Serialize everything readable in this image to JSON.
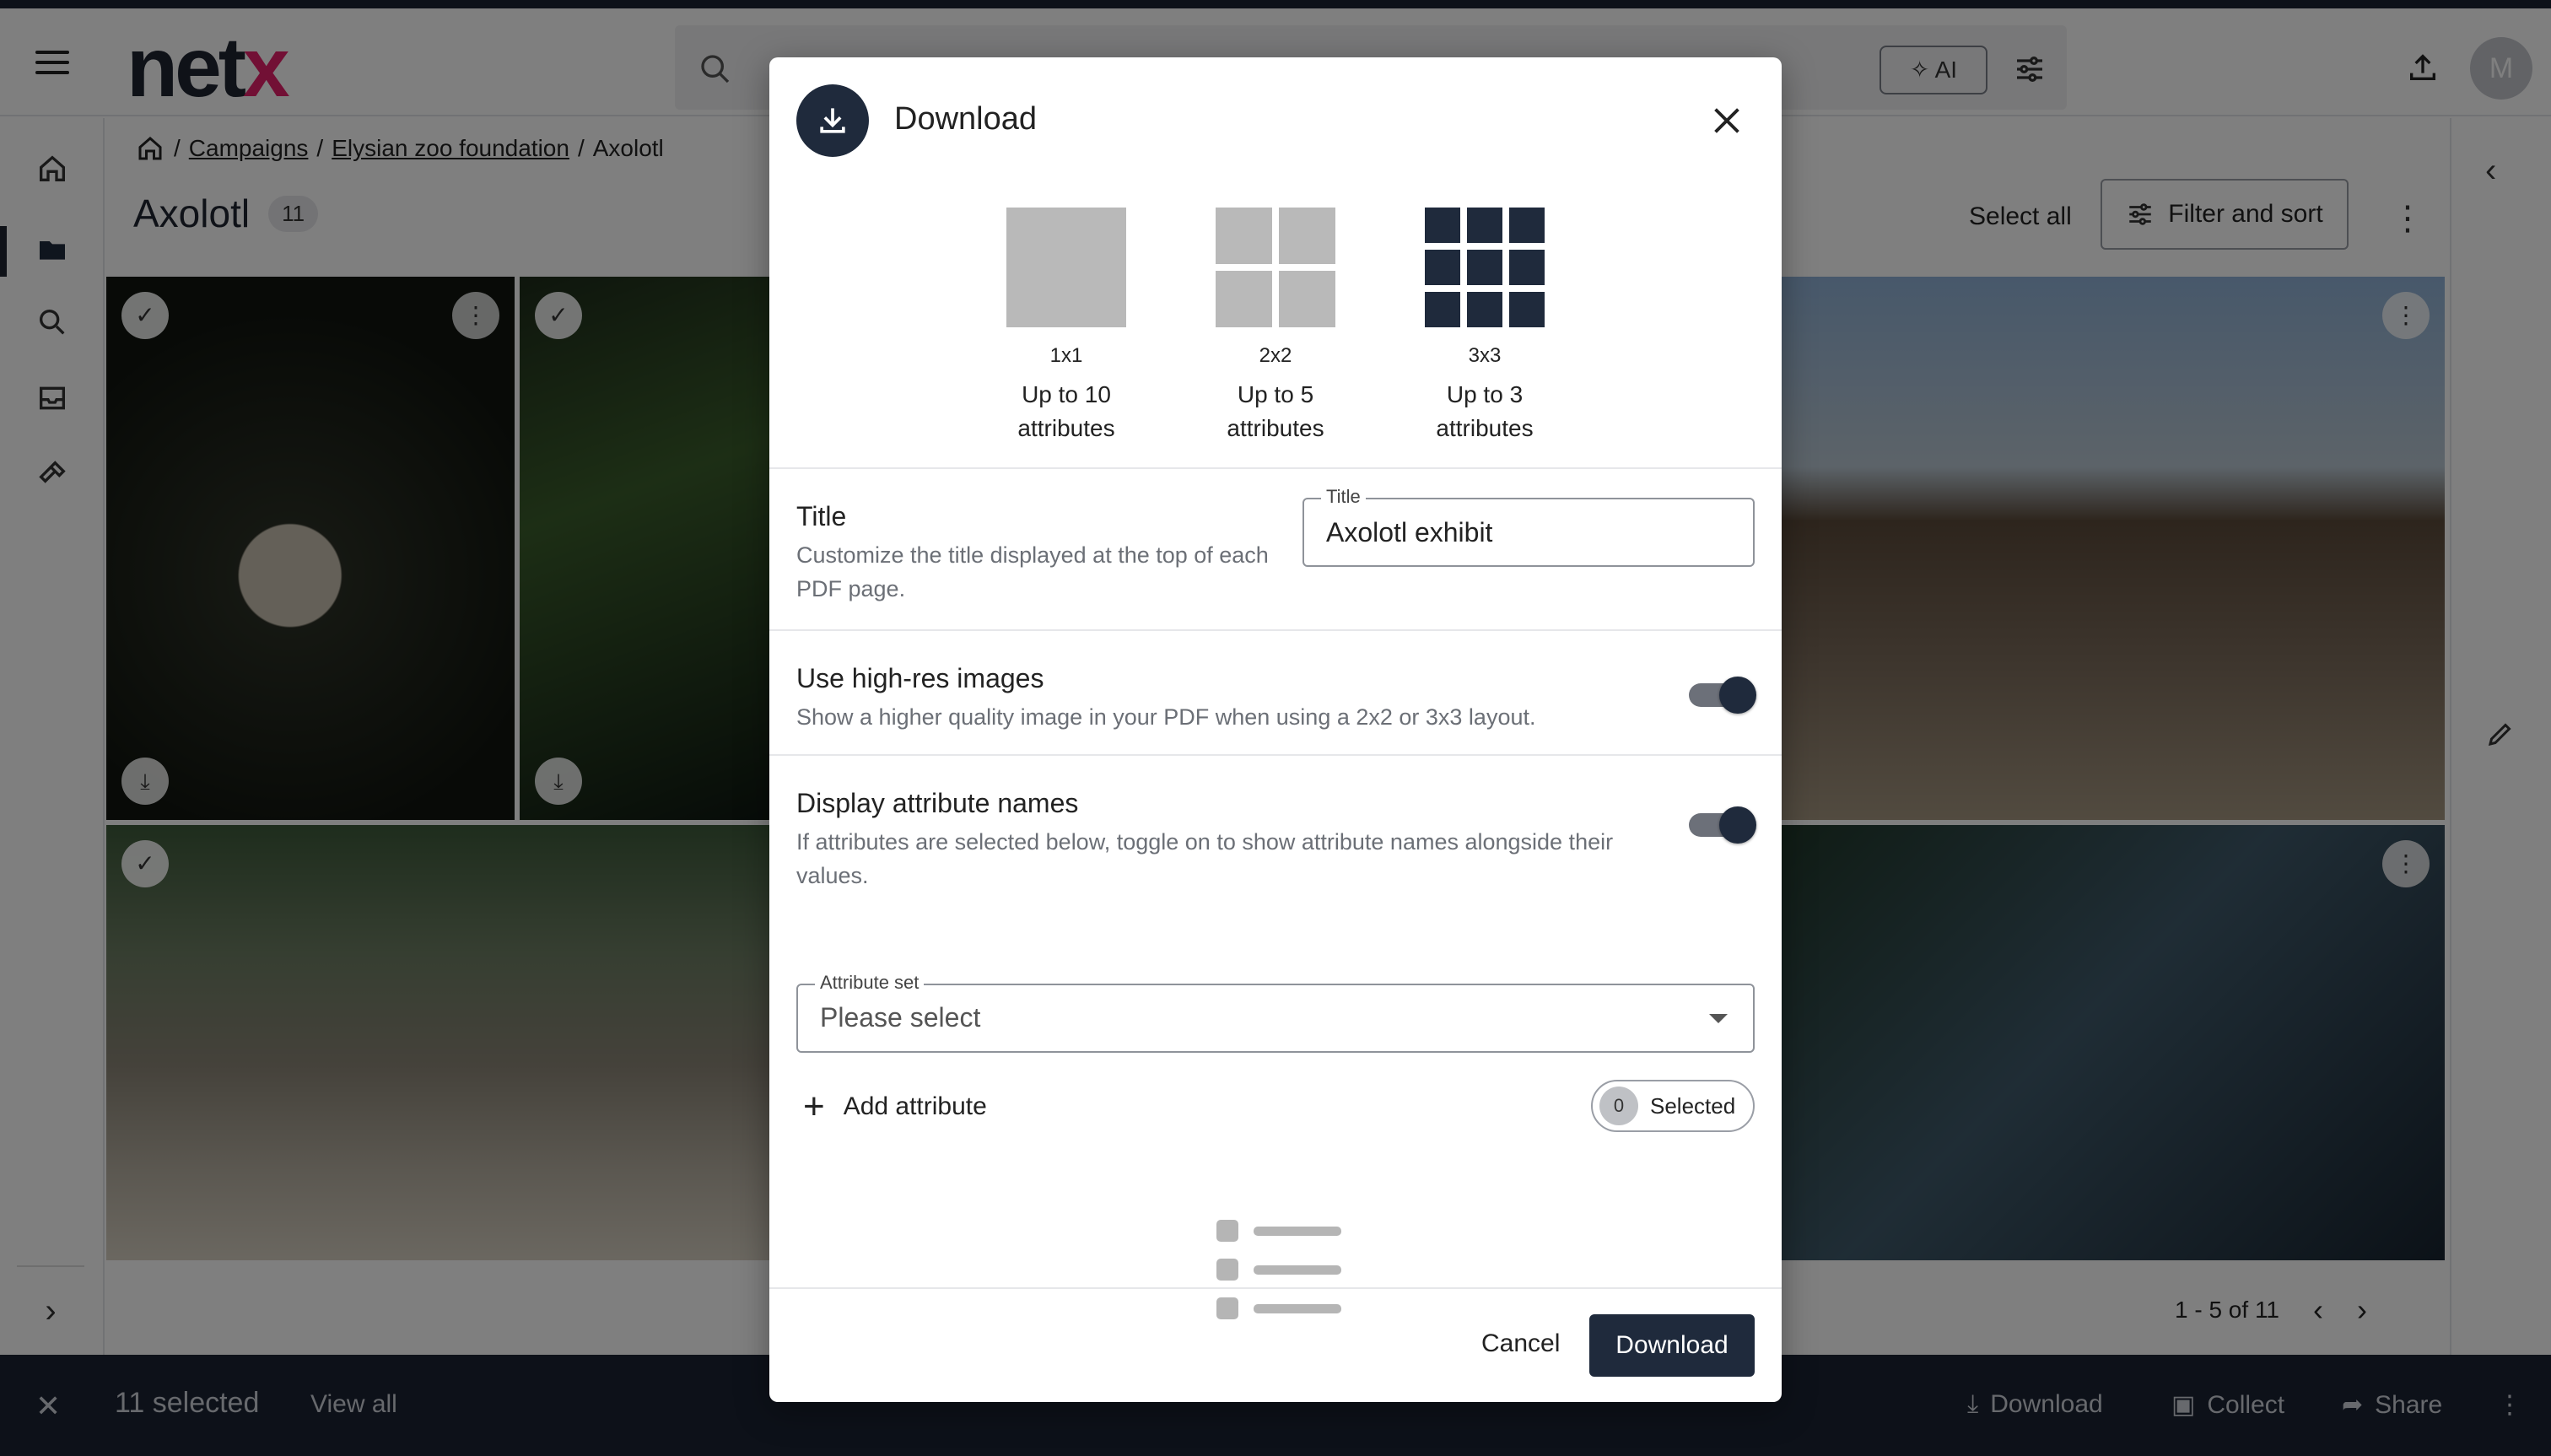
{
  "app": {
    "logo_main": "net",
    "logo_accent": "x",
    "search_ai_label": "AI",
    "avatar_initial": "M"
  },
  "breadcrumb": {
    "items": [
      "Campaigns",
      "Elysian zoo foundation"
    ],
    "current": "Axolotl"
  },
  "folder": {
    "title": "Axolotl",
    "count": "11",
    "select_all": "Select all",
    "filter_label": "Filter and sort"
  },
  "pager": {
    "range": "1 - 5 of 11"
  },
  "selection_bar": {
    "selected": "11 selected",
    "view_all": "View all",
    "download": "Download",
    "collect": "Collect",
    "share": "Share"
  },
  "modal": {
    "title": "Download",
    "layouts": [
      {
        "code": "1x1",
        "line1": "Up to 10",
        "line2": "attributes"
      },
      {
        "code": "2x2",
        "line1": "Up to 5",
        "line2": "attributes"
      },
      {
        "code": "3x3",
        "line1": "Up to 3",
        "line2": "attributes"
      }
    ],
    "title_section": {
      "heading": "Title",
      "description": "Customize the title displayed at the top of each PDF page.",
      "field_label": "Title",
      "field_value": "Axolotl exhibit"
    },
    "hires": {
      "heading": "Use high-res images",
      "description": "Show a higher quality image in your PDF when using a 2x2 or 3x3 layout.",
      "enabled": true
    },
    "attr_names": {
      "heading": "Display attribute names",
      "description": "If attributes are selected below, toggle on to show attribute names alongside their values.",
      "enabled": true
    },
    "attribute_set": {
      "label": "Attribute set",
      "placeholder": "Please select"
    },
    "add_attribute": "Add attribute",
    "selected_count": "0",
    "selected_label": "Selected",
    "cancel": "Cancel",
    "download": "Download"
  },
  "colors": {
    "primary": "#1f2a3c",
    "accent": "#e5206a",
    "placeholder_tile": "#b9b9b9"
  }
}
